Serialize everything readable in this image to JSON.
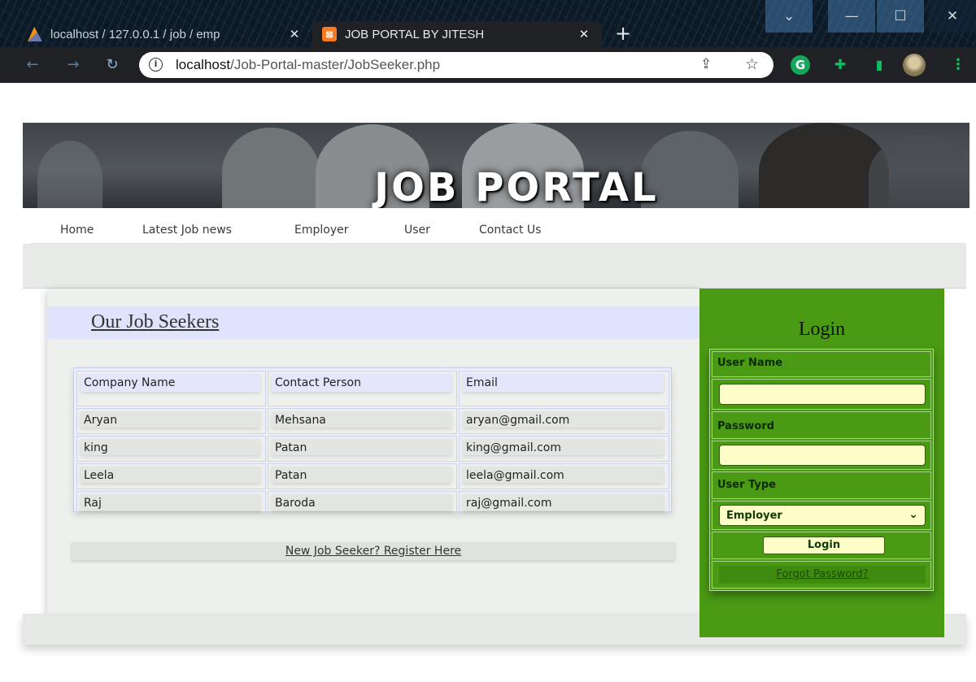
{
  "browser": {
    "tabs": [
      {
        "label": "localhost / 127.0.0.1 / job / emp",
        "active": false
      },
      {
        "label": "JOB PORTAL BY JITESH",
        "active": true
      }
    ],
    "url_host": "localhost",
    "url_path": "/Job-Portal-master/JobSeeker.php",
    "xampp_icon": "xampp-icon",
    "pma_icon": "phpmyadmin-icon"
  },
  "header": {
    "banner_title": "JOB PORTAL"
  },
  "nav": {
    "items": [
      "Home",
      "Latest Job news",
      "Employer",
      "User",
      "Contact Us"
    ]
  },
  "main": {
    "section_title": "Our Job Seekers",
    "table": {
      "columns": [
        "Company Name",
        "Contact Person",
        "Email"
      ],
      "rows": [
        [
          "Aryan",
          "Mehsana",
          "aryan@gmail.com"
        ],
        [
          "king",
          "Patan",
          "king@gmail.com"
        ],
        [
          "Leela",
          "Patan",
          "leela@gmail.com"
        ],
        [
          "Raj",
          "Baroda",
          "raj@gmail.com"
        ]
      ]
    },
    "register_link": "New Job Seeker? Register Here"
  },
  "login": {
    "title": "Login",
    "username_label": "User Name",
    "username_value": "",
    "password_label": "Password",
    "password_value": "",
    "usertype_label": "User Type",
    "usertype_selected": "Employer",
    "login_button": "Login",
    "forgot_link": "Forgot Password?"
  },
  "colors": {
    "login_panel": "#4a9a14",
    "section_header": "#dfe3fb",
    "input_bg": "#fefdc8"
  }
}
